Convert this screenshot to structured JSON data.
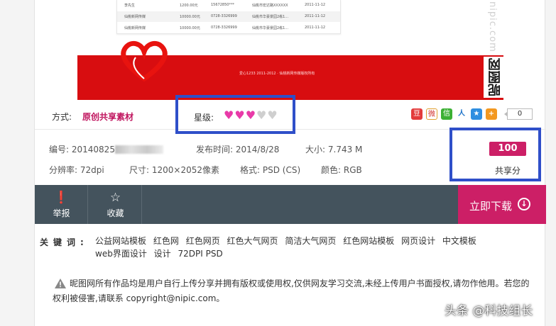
{
  "preview": {
    "doc_rows": [
      {
        "name": "李先生",
        "amount": "1200.00元",
        "phone": "15672850***",
        "addr": "仙桃市宏达路XXXXXX",
        "date": "2011-11-12"
      },
      {
        "name": "仙桃新网传媒",
        "amount": "10000.00元",
        "phone": "0728-3326999",
        "addr": "仙桃市华豪景园2栋1...",
        "date": "2011-11-12"
      },
      {
        "name": "仙桃新网传媒",
        "amount": "10000.00元",
        "phone": "0728-3326999",
        "addr": "仙桃市华豪景园2栋1...",
        "date": "2011-11-12"
      }
    ],
    "banner_caption": "爱心1233 2011-2012 · 仙桃新网传媒版权所有",
    "watermark_light": "nipic.com",
    "watermark_dark": "昵图网"
  },
  "meta": {
    "method_label": "方式:",
    "method_value": "原创共享素材",
    "rating_label": "星级:",
    "rating": {
      "filled": 3,
      "total": 5
    },
    "share_count": "0"
  },
  "info": {
    "id_label": "编号:",
    "id_value": "20140825",
    "publish_label": "发布时间:",
    "publish_value": "2014/8/28",
    "size_label": "大小:",
    "size_value": "7.743 M",
    "resolution_label": "分辨率:",
    "resolution_value": "72dpi",
    "dimension_label": "尺寸:",
    "dimension_value": "1200×2052像素",
    "format_label": "格式:",
    "format_value": "PSD (CS)",
    "color_label": "颜色:",
    "color_value": "RGB"
  },
  "score": {
    "value": "100",
    "label": "共享分"
  },
  "actions": {
    "report": "举报",
    "favorite": "收藏",
    "download": "立即下载"
  },
  "keywords": {
    "label": "关键词:",
    "items": [
      "公益网站模板",
      "红色网",
      "红色网页",
      "红色大气网页",
      "简洁大气网页",
      "红色网站模板",
      "网页设计",
      "中文模板",
      "web界面设计",
      "设计",
      "72DPI PSD"
    ]
  },
  "notice": {
    "text": "昵图网所有作品均是用户自行上传分享并拥有版权或使用权,仅供网友学习交流,未经上传用户书面授权,请勿作他用。若您的权利被侵害,请联系 copyright@nipic.com。"
  },
  "credit": "头条 @科技组长",
  "colors": {
    "brand": "#cc1f66",
    "bar": "#44535d",
    "highlight": "#2f4fc9",
    "banner": "#d80d10"
  }
}
